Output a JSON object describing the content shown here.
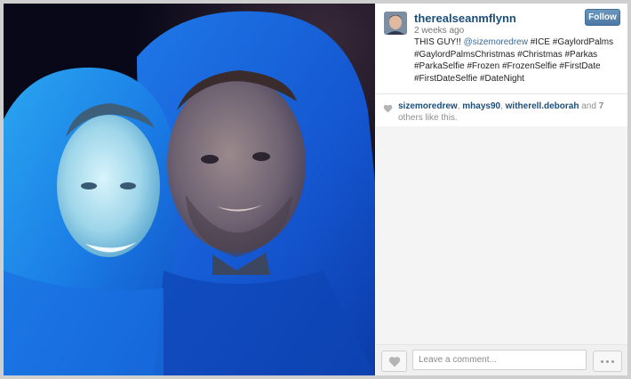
{
  "post": {
    "username": "therealseanmflynn",
    "timestamp": "2 weeks ago",
    "follow_label": "Follow",
    "caption": {
      "intro": "THIS GUY!! ",
      "mention": "@sizemoredrew",
      "hashtags": " #ICE #GaylordPalms #GaylordPalmsChristmas #Christmas #Parkas #ParkaSelfie #Frozen #FrozenSelfie #FirstDate #FirstDateSelfie #DateNight"
    }
  },
  "likes": {
    "liker_1": "sizemoredrew",
    "sep_1": ", ",
    "liker_2": "mhays90",
    "sep_2": ", ",
    "liker_3": "witherell.deborah",
    "and_text": " and ",
    "others_count": "7",
    "suffix": " others like this."
  },
  "comment_bar": {
    "placeholder": "Leave a comment..."
  },
  "icons": {
    "heart": "heart-icon",
    "more": "more-dots-icon"
  },
  "colors": {
    "username": "#1b4e7a",
    "follow_button": "#4a78a4",
    "parka_blue": "#1f6fe0"
  }
}
